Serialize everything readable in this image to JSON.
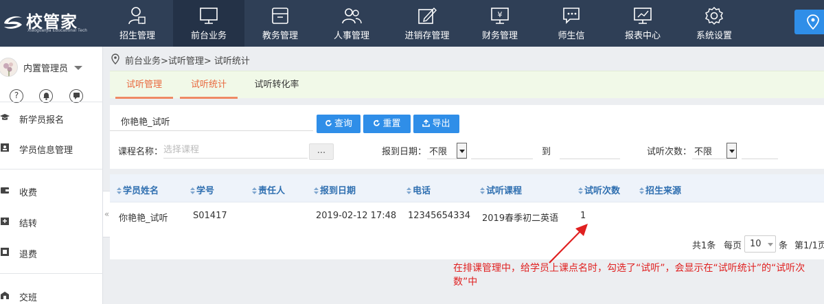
{
  "app": {
    "logo_text": "校管家",
    "logo_subtitle": "Xiaoguanjia Educational Tech"
  },
  "nav": {
    "items": [
      {
        "label": "招生管理",
        "icon": "recruit-icon"
      },
      {
        "label": "前台业务",
        "icon": "monitor-icon",
        "active": true
      },
      {
        "label": "教务管理",
        "icon": "box-icon"
      },
      {
        "label": "人事管理",
        "icon": "people-icon"
      },
      {
        "label": "进销存管理",
        "icon": "edit-icon"
      },
      {
        "label": "财务管理",
        "icon": "finance-icon"
      },
      {
        "label": "师生信",
        "icon": "chat-icon"
      },
      {
        "label": "报表中心",
        "icon": "report-icon"
      },
      {
        "label": "系统设置",
        "icon": "gear-icon"
      }
    ]
  },
  "user": {
    "name": "内置管理员",
    "icons": [
      "help-icon",
      "bell-icon",
      "message-icon"
    ]
  },
  "sidebar": {
    "items": [
      {
        "label": "新学员报名",
        "icon": "graduation-cap-icon"
      },
      {
        "label": "学员信息管理",
        "icon": "id-card-icon"
      },
      {
        "label": "收费",
        "icon": "wallet-icon"
      },
      {
        "label": "结转",
        "icon": "transfer-icon"
      },
      {
        "label": "退费",
        "icon": "refund-icon"
      },
      {
        "label": "交班",
        "icon": "handover-icon"
      }
    ]
  },
  "breadcrumb": {
    "text": "前台业务>试听管理> 试听统计"
  },
  "tabs": [
    {
      "label": "试听管理",
      "active": true
    },
    {
      "label": "试听统计",
      "active": true
    },
    {
      "label": "试听转化率",
      "active": false
    }
  ],
  "filters": {
    "search_value": "你艳艳_试听",
    "buttons": {
      "query": "查询",
      "reset": "重置",
      "export": "导出"
    },
    "course_label": "课程名称：",
    "course_placeholder": "选择课程",
    "course_button": "...",
    "date_label": "报到日期：",
    "date_select": "不限",
    "to_label": "到",
    "count_label": "试听次数：",
    "count_select": "不限"
  },
  "table": {
    "columns": [
      "学员姓名",
      "学号",
      "责任人",
      "报到日期",
      "电话",
      "试听课程",
      "试听次数",
      "招生来源"
    ],
    "rows": [
      [
        "你艳艳_试听",
        "S01417",
        "",
        "2019-02-12 17:48",
        "12345654334",
        "2019春季初二英语",
        "1",
        ""
      ]
    ]
  },
  "pagination": {
    "total": "共1条",
    "per_page_label": "每页",
    "per_page": "10",
    "unit": "条",
    "page_info": "第1/1页"
  },
  "annotation": {
    "text": "在排课管理中，给学员上课点名时，勾选了“试听”，会显示在“试听统计”的“试听次数”中",
    "color": "#e02020"
  },
  "colors": {
    "topbar": "#2f3f56",
    "accent": "#2f8ee8",
    "tab_active": "#e9683e"
  }
}
